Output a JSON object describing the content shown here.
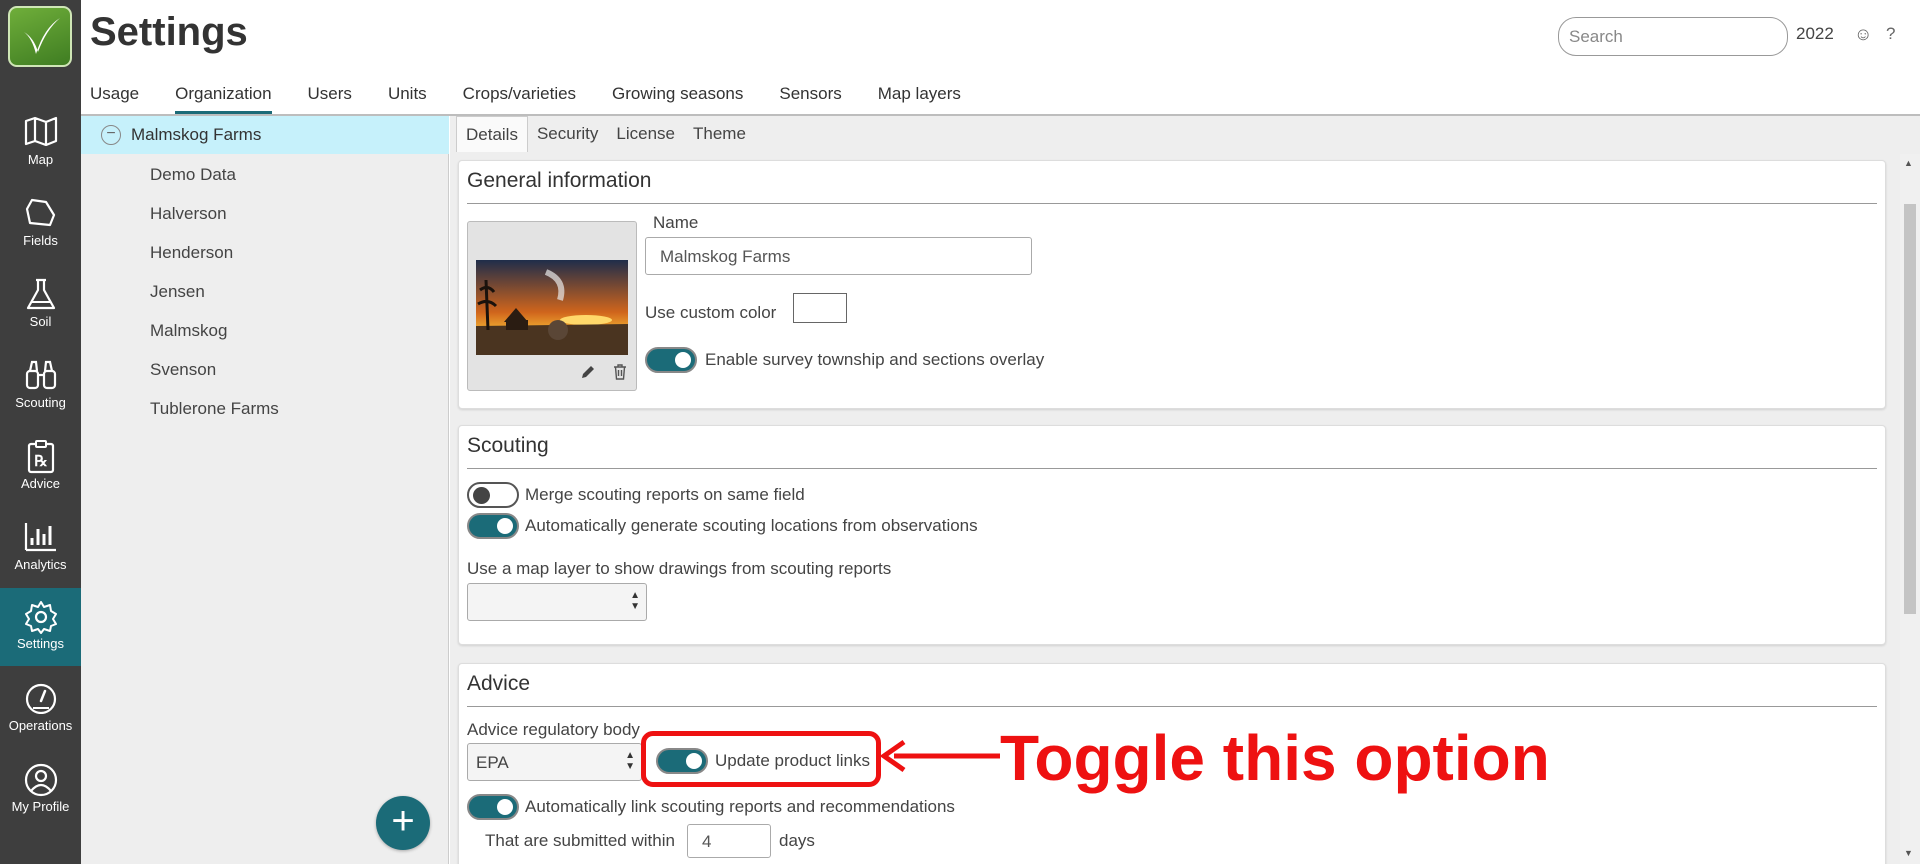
{
  "nav": {
    "items": [
      {
        "label": "Map",
        "icon": "map-icon"
      },
      {
        "label": "Fields",
        "icon": "fields-icon"
      },
      {
        "label": "Soil",
        "icon": "flask-icon"
      },
      {
        "label": "Scouting",
        "icon": "binoculars-icon"
      },
      {
        "label": "Advice",
        "icon": "prescription-icon"
      },
      {
        "label": "Analytics",
        "icon": "bar-chart-icon"
      },
      {
        "label": "Settings",
        "icon": "gear-icon"
      },
      {
        "label": "Operations",
        "icon": "gauge-icon"
      },
      {
        "label": "My Profile",
        "icon": "user-icon"
      }
    ],
    "active": "Settings"
  },
  "header": {
    "title": "Settings",
    "search_placeholder": "Search",
    "year": "2022",
    "smiley": "☺",
    "help": "?"
  },
  "top_tabs": [
    "Usage",
    "Organization",
    "Users",
    "Units",
    "Crops/varieties",
    "Growing seasons",
    "Sensors",
    "Map layers"
  ],
  "top_tabs_active": "Organization",
  "tree": {
    "root": "Malmskog Farms",
    "children": [
      "Demo Data",
      "Halverson",
      "Henderson",
      "Jensen",
      "Malmskog",
      "Svenson",
      "Tublerone Farms"
    ]
  },
  "add_button": "+",
  "sub_tabs": [
    "Details",
    "Security",
    "License",
    "Theme"
  ],
  "sub_tabs_active": "Details",
  "general": {
    "title": "General information",
    "name_label": "Name",
    "name_value": "Malmskog Farms",
    "custom_color_label": "Use custom color",
    "survey_label": "Enable survey township and sections overlay",
    "survey_on": true
  },
  "scouting": {
    "title": "Scouting",
    "merge_label": "Merge scouting reports on same field",
    "merge_on": false,
    "auto_label": "Automatically generate scouting locations from observations",
    "auto_on": true,
    "map_layer_label": "Use a map layer to show drawings from scouting reports",
    "map_layer_value": ""
  },
  "advice": {
    "title": "Advice",
    "regulatory_label": "Advice regulatory body",
    "regulatory_value": "EPA",
    "update_links_label": "Update product links",
    "update_links_on": true,
    "auto_link_label": "Automatically link scouting reports and recommendations",
    "auto_link_on": true,
    "submitted_label": "That are submitted within",
    "submitted_value": "4",
    "days_label": "days"
  },
  "annotation": {
    "text": "Toggle this option",
    "color": "#ee1111"
  },
  "colors": {
    "accent": "#1b6b78",
    "nav_bg": "#3e3e3e",
    "tree_selected": "#c6f1fb"
  }
}
